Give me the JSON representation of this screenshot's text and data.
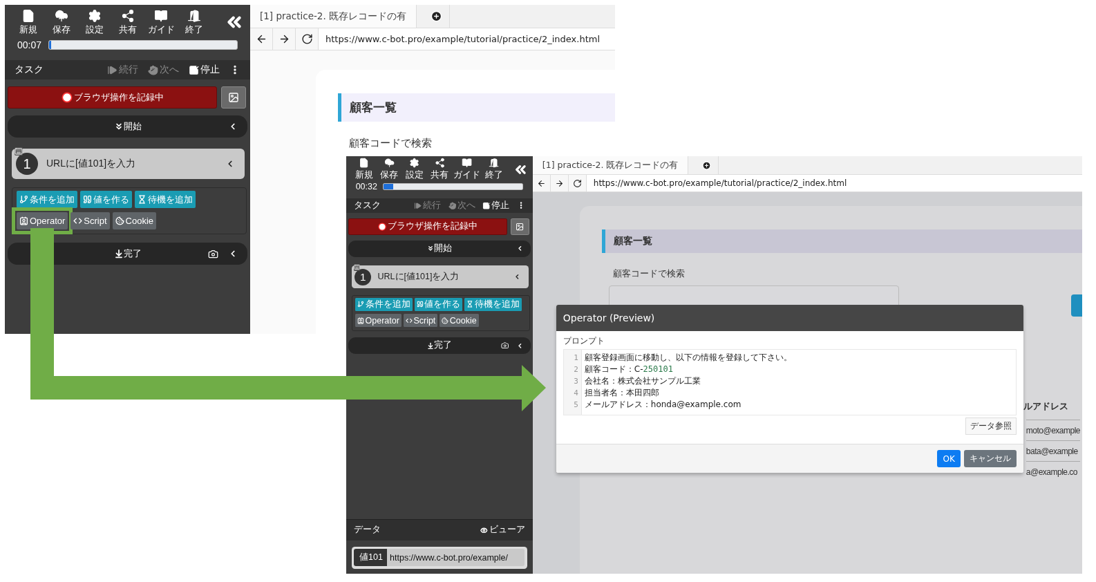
{
  "screenshots": [
    {
      "panel": {
        "toolbar": [
          {
            "kind": "new",
            "label": "新規"
          },
          {
            "kind": "save",
            "label": "保存"
          },
          {
            "kind": "settings",
            "label": "設定"
          },
          {
            "kind": "share",
            "label": "共有"
          },
          {
            "kind": "guide",
            "label": "ガイド"
          },
          {
            "kind": "exit",
            "label": "終了"
          }
        ],
        "timer": "00:07",
        "progress": {
          "level": 0.01
        },
        "task_bar": {
          "title": "タスク",
          "actions": [
            {
              "kind": "continue",
              "label": "続行",
              "disabled": true
            },
            {
              "kind": "next",
              "label": "次へ",
              "disabled": true
            },
            {
              "kind": "stop",
              "label": "停止",
              "disabled": false
            }
          ]
        },
        "record_button": "ブラウザ操作を記録中",
        "start_section": "開始",
        "steps": [
          {
            "number": "1",
            "label": "URLに[値101]を入力"
          }
        ],
        "add_buttons": [
          {
            "kind": "condition",
            "label": "条件を追加",
            "highlighted": false
          },
          {
            "kind": "value",
            "label": "値を作る",
            "highlighted": false
          },
          {
            "kind": "wait",
            "label": "待機を追加",
            "highlighted": false
          },
          {
            "kind": "operator",
            "label": "Operator",
            "highlighted": true
          },
          {
            "kind": "script",
            "label": "Script",
            "highlighted": false
          },
          {
            "kind": "cookie",
            "label": "Cookie",
            "highlighted": false
          }
        ],
        "end_section": "完了"
      },
      "browser": {
        "tabs": [
          {
            "label": "[1] practice-2. 既存レコードの有",
            "selected": true
          }
        ],
        "url": "https://www.c-bot.pro/example/tutorial/practice/2_index.html",
        "dimmed": false,
        "page": {
          "heading": "顧客一覧",
          "search_label": "顧客コードで検索"
        }
      }
    },
    {
      "panel": {
        "toolbar": [
          {
            "kind": "new",
            "label": "新規"
          },
          {
            "kind": "save",
            "label": "保存"
          },
          {
            "kind": "settings",
            "label": "設定"
          },
          {
            "kind": "share",
            "label": "共有"
          },
          {
            "kind": "guide",
            "label": "ガイド"
          },
          {
            "kind": "exit",
            "label": "終了"
          }
        ],
        "timer": "00:32",
        "progress": {
          "level": 0.07
        },
        "task_bar": {
          "title": "タスク",
          "actions": [
            {
              "kind": "continue",
              "label": "続行",
              "disabled": true
            },
            {
              "kind": "next",
              "label": "次へ",
              "disabled": true
            },
            {
              "kind": "stop",
              "label": "停止",
              "disabled": false
            }
          ]
        },
        "record_button": "ブラウザ操作を記録中",
        "start_section": "開始",
        "steps": [
          {
            "number": "1",
            "label": "URLに[値101]を入力"
          }
        ],
        "add_buttons": [
          {
            "kind": "condition",
            "label": "条件を追加",
            "highlighted": false
          },
          {
            "kind": "value",
            "label": "値を作る",
            "highlighted": false
          },
          {
            "kind": "wait",
            "label": "待機を追加",
            "highlighted": false
          },
          {
            "kind": "operator",
            "label": "Operator",
            "highlighted": false
          },
          {
            "kind": "script",
            "label": "Script",
            "highlighted": false
          },
          {
            "kind": "cookie",
            "label": "Cookie",
            "highlighted": false
          }
        ],
        "end_section": "完了",
        "data_section": {
          "title": "データ",
          "viewer": "ビューア",
          "items": [
            {
              "name": "値101",
              "value": "https://www.c-bot.pro/example/"
            }
          ]
        }
      },
      "browser": {
        "tabs": [
          {
            "label": "[1] practice-2. 既存レコードの有",
            "selected": true
          }
        ],
        "url": "https://www.c-bot.pro/example/tutorial/practice/2_index.html",
        "dimmed": true,
        "page": {
          "heading": "顧客一覧",
          "search_label": "顧客コードで検索",
          "column_header": "ルアドレス",
          "cells": [
            "moto@example",
            "bata@example",
            "a@example.co"
          ]
        },
        "dialog": {
          "title": "Operator (Preview)",
          "label": "プロンプト",
          "lines": [
            {
              "number": "1",
              "parts": [
                {
                  "kind": "text",
                  "text": "顧客登録画面に移動し、以下の情報を登録して下さい。"
                }
              ]
            },
            {
              "number": "2",
              "parts": [
                {
                  "kind": "text",
                  "text": "顧客コード：C-"
                },
                {
                  "kind": "number",
                  "text": "250101"
                }
              ]
            },
            {
              "number": "3",
              "parts": [
                {
                  "kind": "text",
                  "text": "会社名：株式会社サンプル工業"
                }
              ]
            },
            {
              "number": "4",
              "parts": [
                {
                  "kind": "text",
                  "text": "担当者名：本田四郎"
                }
              ]
            },
            {
              "number": "5",
              "parts": [
                {
                  "kind": "text",
                  "text": "メールアドレス：honda@example.com"
                }
              ]
            }
          ],
          "data_button": "データ参照",
          "buttons": [
            {
              "kind": "primary",
              "label": "OK"
            },
            {
              "kind": "secondary",
              "label": "キャンセル"
            }
          ]
        }
      }
    }
  ]
}
